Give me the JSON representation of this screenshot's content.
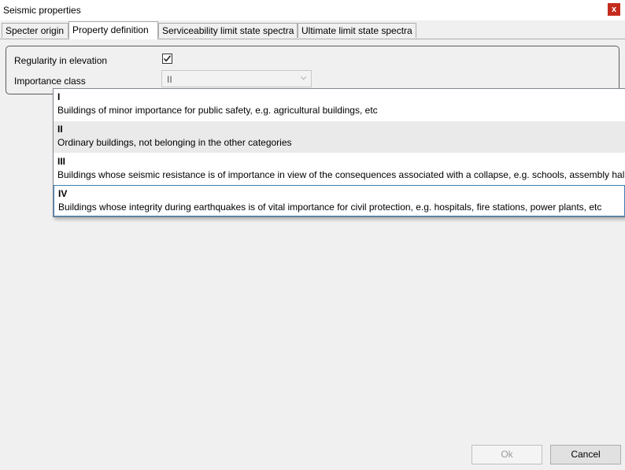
{
  "window": {
    "title": "Seismic properties",
    "close_glyph": "x"
  },
  "tabs": [
    {
      "label": "Specter origin",
      "active": false
    },
    {
      "label": "Property definition",
      "active": true
    },
    {
      "label": "Serviceability limit state spectra",
      "active": false
    },
    {
      "label": "Ultimate limit state spectra",
      "active": false
    }
  ],
  "form": {
    "regularity_label": "Regularity in elevation",
    "regularity_checked": true,
    "importance_label": "Importance class",
    "importance_value": "II"
  },
  "dropdown": {
    "options": [
      {
        "code": "I",
        "description": "Buildings of minor importance for public safety, e.g. agricultural buildings, etc"
      },
      {
        "code": "II",
        "description": "Ordinary buildings, not belonging in the other categories"
      },
      {
        "code": "III",
        "description": "Buildings whose seismic resistance is of importance in view of the consequences associated with a collapse, e.g. schools, assembly halls, c"
      },
      {
        "code": "IV",
        "description": "Buildings whose integrity during earthquakes is of vital importance for civil protection, e.g. hospitals, fire stations, power plants, etc"
      }
    ],
    "selected_index": 1,
    "hovered_index": 3
  },
  "buttons": {
    "ok_label": "Ok",
    "ok_enabled": false,
    "cancel_label": "Cancel"
  },
  "colors": {
    "close_button": "#c42b1c",
    "highlight_border": "#3c7fb1",
    "selected_background": "#eaeaea"
  }
}
